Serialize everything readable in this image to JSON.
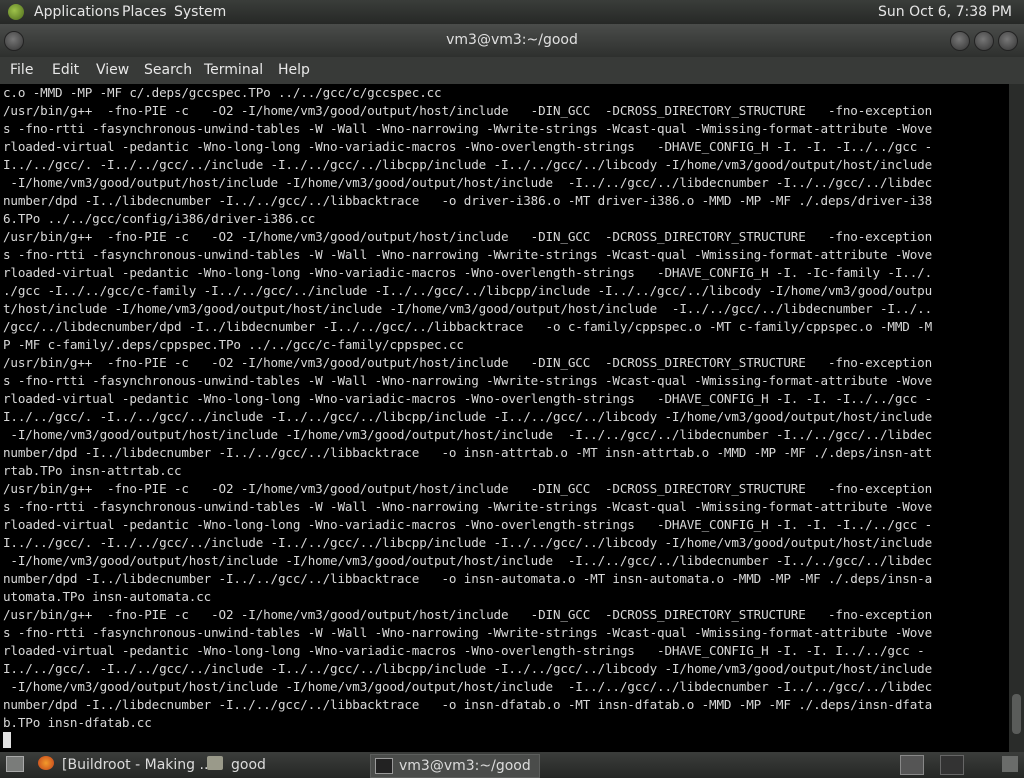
{
  "top_panel": {
    "applications": "Applications",
    "places": "Places",
    "system": "System",
    "clock": "Sun Oct  6,  7:38 PM"
  },
  "window": {
    "title": "vm3@vm3:~/good"
  },
  "menubar": {
    "file": "File",
    "edit": "Edit",
    "view": "View",
    "search": "Search",
    "terminal": "Terminal",
    "help": "Help"
  },
  "terminal": {
    "lines": [
      "c.o -MMD -MP -MF c/.deps/gccspec.TPo ../../gcc/c/gccspec.cc",
      "/usr/bin/g++  -fno-PIE -c   -O2 -I/home/vm3/good/output/host/include   -DIN_GCC  -DCROSS_DIRECTORY_STRUCTURE   -fno-exception",
      "s -fno-rtti -fasynchronous-unwind-tables -W -Wall -Wno-narrowing -Wwrite-strings -Wcast-qual -Wmissing-format-attribute -Wove",
      "rloaded-virtual -pedantic -Wno-long-long -Wno-variadic-macros -Wno-overlength-strings   -DHAVE_CONFIG_H -I. -I. -I../../gcc -",
      "I../../gcc/. -I../../gcc/../include -I../../gcc/../libcpp/include -I../../gcc/../libcody -I/home/vm3/good/output/host/include",
      " -I/home/vm3/good/output/host/include -I/home/vm3/good/output/host/include  -I../../gcc/../libdecnumber -I../../gcc/../libdec",
      "number/dpd -I../libdecnumber -I../../gcc/../libbacktrace   -o driver-i386.o -MT driver-i386.o -MMD -MP -MF ./.deps/driver-i38",
      "6.TPo ../../gcc/config/i386/driver-i386.cc",
      "/usr/bin/g++  -fno-PIE -c   -O2 -I/home/vm3/good/output/host/include   -DIN_GCC  -DCROSS_DIRECTORY_STRUCTURE   -fno-exception",
      "s -fno-rtti -fasynchronous-unwind-tables -W -Wall -Wno-narrowing -Wwrite-strings -Wcast-qual -Wmissing-format-attribute -Wove",
      "rloaded-virtual -pedantic -Wno-long-long -Wno-variadic-macros -Wno-overlength-strings   -DHAVE_CONFIG_H -I. -Ic-family -I../.",
      "./gcc -I../../gcc/c-family -I../../gcc/../include -I../../gcc/../libcpp/include -I../../gcc/../libcody -I/home/vm3/good/outpu",
      "t/host/include -I/home/vm3/good/output/host/include -I/home/vm3/good/output/host/include  -I../../gcc/../libdecnumber -I../..",
      "/gcc/../libdecnumber/dpd -I../libdecnumber -I../../gcc/../libbacktrace   -o c-family/cppspec.o -MT c-family/cppspec.o -MMD -M",
      "P -MF c-family/.deps/cppspec.TPo ../../gcc/c-family/cppspec.cc",
      "/usr/bin/g++  -fno-PIE -c   -O2 -I/home/vm3/good/output/host/include   -DIN_GCC  -DCROSS_DIRECTORY_STRUCTURE   -fno-exception",
      "s -fno-rtti -fasynchronous-unwind-tables -W -Wall -Wno-narrowing -Wwrite-strings -Wcast-qual -Wmissing-format-attribute -Wove",
      "rloaded-virtual -pedantic -Wno-long-long -Wno-variadic-macros -Wno-overlength-strings   -DHAVE_CONFIG_H -I. -I. -I../../gcc -",
      "I../../gcc/. -I../../gcc/../include -I../../gcc/../libcpp/include -I../../gcc/../libcody -I/home/vm3/good/output/host/include",
      " -I/home/vm3/good/output/host/include -I/home/vm3/good/output/host/include  -I../../gcc/../libdecnumber -I../../gcc/../libdec",
      "number/dpd -I../libdecnumber -I../../gcc/../libbacktrace   -o insn-attrtab.o -MT insn-attrtab.o -MMD -MP -MF ./.deps/insn-att",
      "rtab.TPo insn-attrtab.cc",
      "/usr/bin/g++  -fno-PIE -c   -O2 -I/home/vm3/good/output/host/include   -DIN_GCC  -DCROSS_DIRECTORY_STRUCTURE   -fno-exception",
      "s -fno-rtti -fasynchronous-unwind-tables -W -Wall -Wno-narrowing -Wwrite-strings -Wcast-qual -Wmissing-format-attribute -Wove",
      "rloaded-virtual -pedantic -Wno-long-long -Wno-variadic-macros -Wno-overlength-strings   -DHAVE_CONFIG_H -I. -I. -I../../gcc -",
      "I../../gcc/. -I../../gcc/../include -I../../gcc/../libcpp/include -I../../gcc/../libcody -I/home/vm3/good/output/host/include",
      " -I/home/vm3/good/output/host/include -I/home/vm3/good/output/host/include  -I../../gcc/../libdecnumber -I../../gcc/../libdec",
      "number/dpd -I../libdecnumber -I../../gcc/../libbacktrace   -o insn-automata.o -MT insn-automata.o -MMD -MP -MF ./.deps/insn-a",
      "utomata.TPo insn-automata.cc",
      "/usr/bin/g++  -fno-PIE -c   -O2 -I/home/vm3/good/output/host/include   -DIN_GCC  -DCROSS_DIRECTORY_STRUCTURE   -fno-exception",
      "s -fno-rtti -fasynchronous-unwind-tables -W -Wall -Wno-narrowing -Wwrite-strings -Wcast-qual -Wmissing-format-attribute -Wove",
      "rloaded-virtual -pedantic -Wno-long-long -Wno-variadic-macros -Wno-overlength-strings   -DHAVE_CONFIG_H -I. -I. I../../gcc -",
      "I../../gcc/. -I../../gcc/../include -I../../gcc/../libcpp/include -I../../gcc/../libcody -I/home/vm3/good/output/host/include",
      " -I/home/vm3/good/output/host/include -I/home/vm3/good/output/host/include  -I../../gcc/../libdecnumber -I../../gcc/../libdec",
      "number/dpd -I../libdecnumber -I../../gcc/../libbacktrace   -o insn-dfatab.o -MT insn-dfatab.o -MMD -MP -MF ./.deps/insn-dfata",
      "b.TPo insn-dfatab.cc"
    ]
  },
  "taskbar": {
    "browser": "[Buildroot - Making ...",
    "files": "good",
    "terminal": "vm3@vm3:~/good"
  }
}
